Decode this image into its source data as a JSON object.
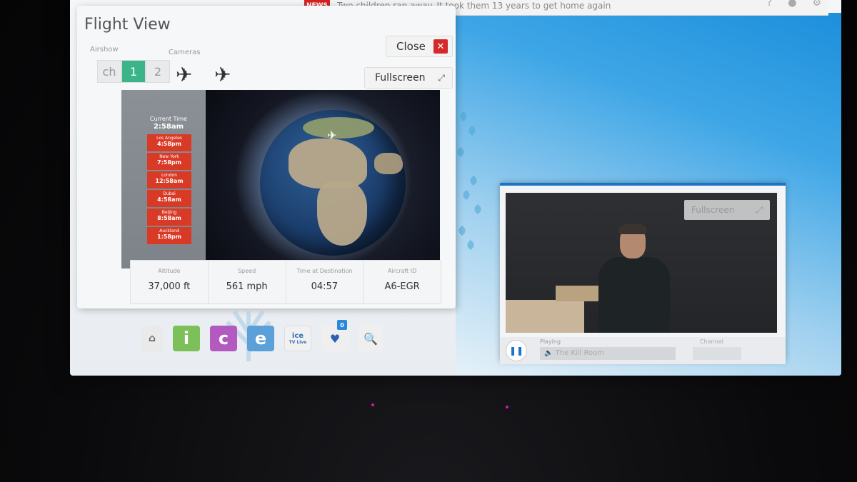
{
  "ticker": {
    "badge": "NEWS",
    "headline": "Two children ran away. It took them 13 years to get home again"
  },
  "flight_view": {
    "title": "Flight View",
    "airshow_label": "Airshow",
    "cameras_label": "Cameras",
    "tabs": [
      "ch",
      "1",
      "2"
    ],
    "active_tab": "1",
    "close_label": "Close",
    "fullscreen_label": "Fullscreen",
    "current_time_label": "Current Time",
    "current_time": "2:58am",
    "cities": [
      {
        "name": "Los Angeles",
        "time": "4:58pm"
      },
      {
        "name": "New York",
        "time": "7:58pm"
      },
      {
        "name": "London",
        "time": "12:58am"
      },
      {
        "name": "Dubai",
        "time": "4:58am"
      },
      {
        "name": "Beijing",
        "time": "8:58am"
      },
      {
        "name": "Auckland",
        "time": "1:58pm"
      }
    ],
    "info": [
      {
        "label": "Altitude",
        "value": "37,000 ft"
      },
      {
        "label": "Speed",
        "value": "561 mph"
      },
      {
        "label": "Time at Destination",
        "value": "04:57"
      },
      {
        "label": "Aircraft ID",
        "value": "A6-EGR"
      }
    ]
  },
  "nav": {
    "home_icon": "home-icon",
    "i_label": "i",
    "c_label": "c",
    "e_label": "e",
    "tv_label_top": "ice",
    "tv_label_bottom": "TV Live",
    "favorites_count": "0",
    "search_icon": "search-icon"
  },
  "video": {
    "fullscreen_label": "Fullscreen",
    "playing_label": "Playing",
    "now_playing": "The Kill Room",
    "channel_label": "Channel"
  },
  "colors": {
    "accent_green": "#3bb48a",
    "city_red": "#d93a26",
    "close_red": "#d62a2a",
    "video_blue": "#1c73c4"
  }
}
